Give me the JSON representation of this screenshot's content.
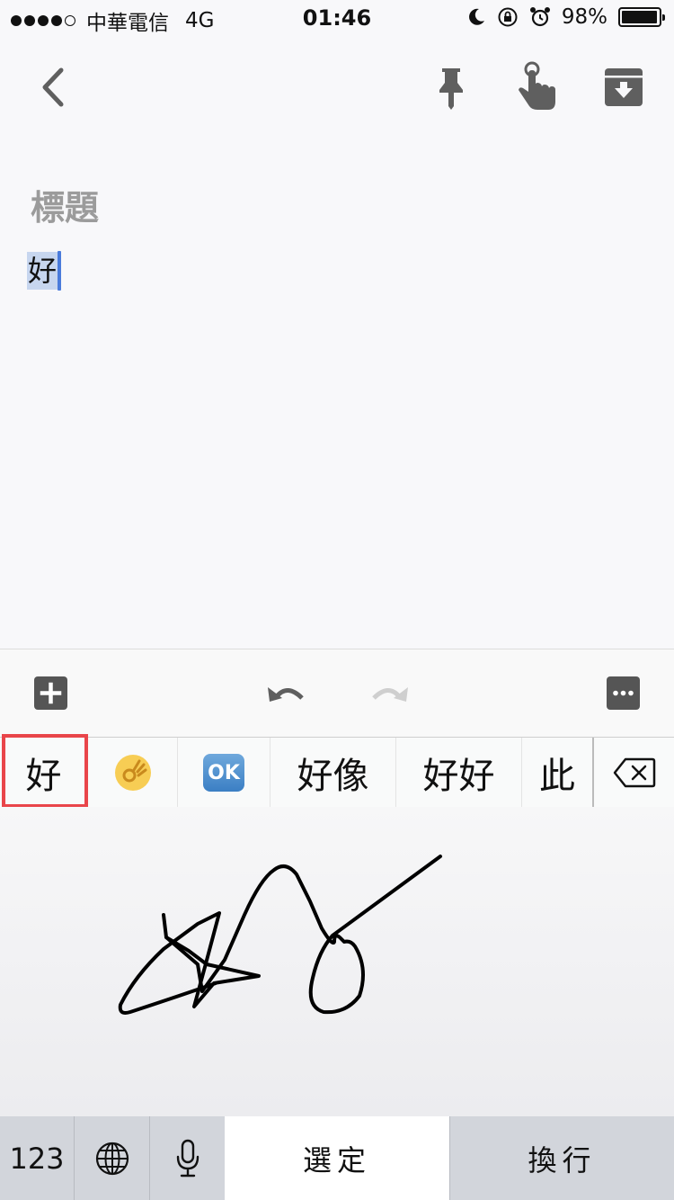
{
  "status_bar": {
    "carrier": "中華電信",
    "network": "4G",
    "time": "01:46",
    "battery": "98%",
    "battery_level": 0.98
  },
  "toolbar": {
    "back_icon": "chevron-left-icon",
    "pin_icon": "pin-icon",
    "reminder_icon": "reminder-finger-icon",
    "archive_icon": "archive-icon"
  },
  "note": {
    "title_placeholder": "標題",
    "body": "好"
  },
  "editor_toolbar": {
    "add_icon": "add-box-icon",
    "undo_icon": "undo-icon",
    "redo_icon": "redo-icon",
    "more_icon": "more-icon"
  },
  "candidates": [
    "好",
    "👌",
    "🆗",
    "好像",
    "好好",
    "此"
  ],
  "keyboard": {
    "numbers_label": "123",
    "globe_icon": "globe-icon",
    "mic_icon": "microphone-icon",
    "select_label": "選定",
    "return_label": "換行",
    "delete_icon": "backspace-icon"
  },
  "colors": {
    "highlight": "#e9454a",
    "selection": "#c7d6ef",
    "caret": "#4a7bdb"
  }
}
